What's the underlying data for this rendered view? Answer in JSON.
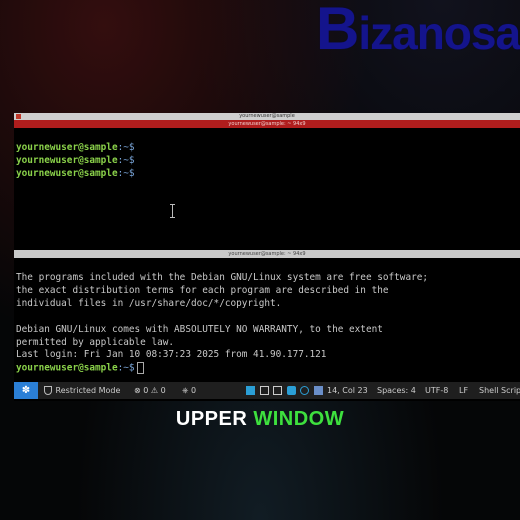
{
  "logo": {
    "first_letter": "B",
    "rest": "izanosa"
  },
  "window": {
    "title": "yournewuser@sample",
    "tab_title": "yournewuser@sample: ~ 94x9",
    "divider_title": "yournewuser@sample: ~ 94x9"
  },
  "upper_pane": {
    "lines": [
      {
        "prompt": "yournewuser@sample",
        "path": ":~$"
      },
      {
        "prompt": "yournewuser@sample",
        "path": ":~$"
      },
      {
        "prompt": "yournewuser@sample",
        "path": ":~$"
      }
    ]
  },
  "lower_pane": {
    "motd": [
      "The programs included with the Debian GNU/Linux system are free software;",
      "the exact distribution terms for each program are described in the",
      "individual files in /usr/share/doc/*/copyright.",
      "",
      "Debian GNU/Linux comes with ABSOLUTELY NO WARRANTY, to the extent",
      "permitted by applicable law.",
      "Last login: Fri Jan 10 08:37:23 2025 from 41.90.177.121"
    ],
    "prompt": "yournewuser@sample",
    "path": ":~$"
  },
  "statusbar": {
    "remote_icon": "remote-icon",
    "restricted_mode": "Restricted Mode",
    "errors": "0",
    "warnings": "0",
    "ports": "0",
    "position": "14, Col 23",
    "spaces": "Spaces: 4",
    "encoding": "UTF-8",
    "eol": "LF",
    "language": "Shell Scrip"
  },
  "caption": {
    "word1": "UPPER",
    "word2": "WINDOW"
  },
  "colors": {
    "accent_red": "#b01d1d",
    "prompt_green": "#8ad14a",
    "statusbar_blue": "#2b7fd6",
    "caption_green": "#3ee03e"
  }
}
